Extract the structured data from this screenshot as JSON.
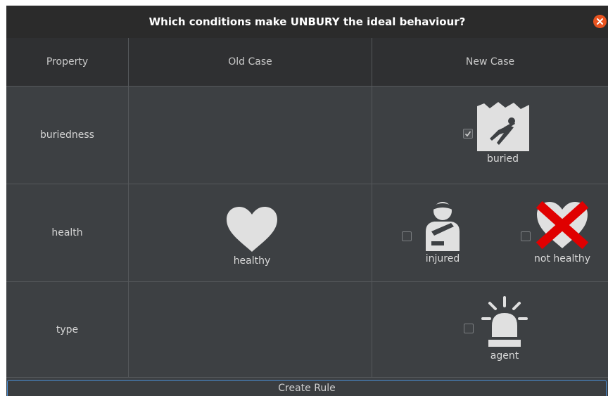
{
  "dialog": {
    "title": "Which conditions make UNBURY the ideal behaviour?"
  },
  "table": {
    "headers": {
      "property": "Property",
      "old_case": "Old Case",
      "new_case": "New Case"
    },
    "rows": [
      {
        "property": "buriedness",
        "old": [],
        "new": [
          {
            "label": "buried",
            "icon": "buried-person-icon",
            "checked": true
          }
        ]
      },
      {
        "property": "health",
        "old": [
          {
            "label": "healthy",
            "icon": "heart-icon"
          }
        ],
        "new": [
          {
            "label": "injured",
            "icon": "injured-person-icon",
            "checked": false
          },
          {
            "label": "not healthy",
            "icon": "crossed-heart-icon",
            "checked": false
          }
        ]
      },
      {
        "property": "type",
        "old": [],
        "new": [
          {
            "label": "agent",
            "icon": "siren-light-icon",
            "checked": false
          }
        ]
      }
    ]
  },
  "footer": {
    "create_rule_label": "Create Rule"
  },
  "colors": {
    "title_bar": "#2b2b2b",
    "close_button": "#e95420",
    "cross_red": "#e00000",
    "icon_fill": "#e0e0e0",
    "focus_border": "#4a90d9"
  }
}
